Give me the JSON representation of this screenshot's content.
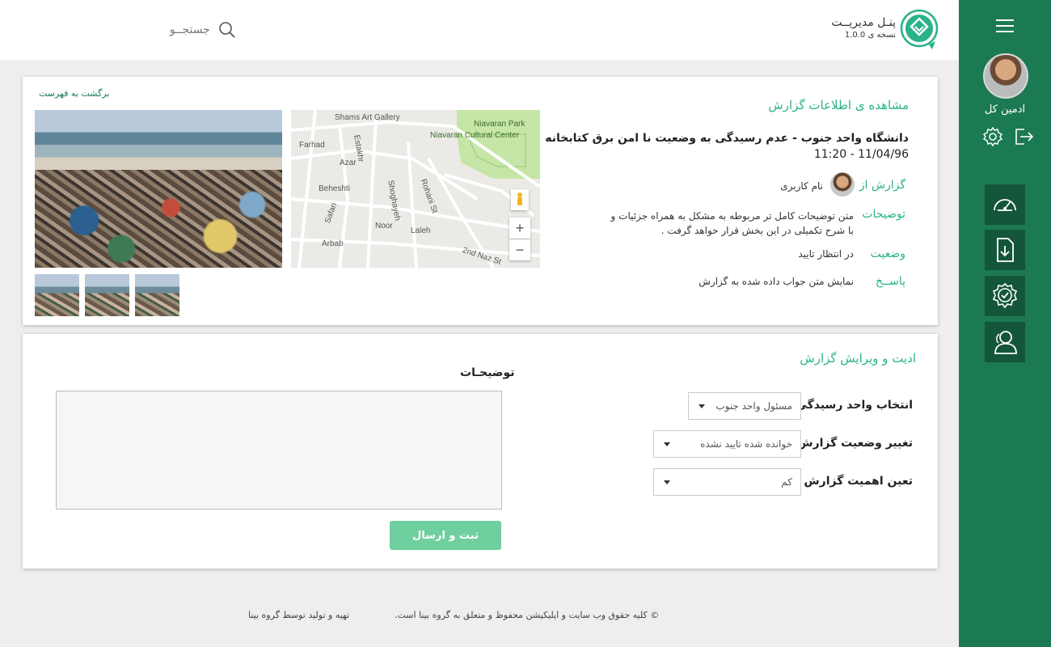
{
  "header": {
    "brand_title": "پنـل مدیریــت",
    "brand_version": "نسخه ی 1.0.0",
    "search_label": "جستجــو"
  },
  "sidebar": {
    "user_name": "ادمین کل",
    "nav_icons": [
      "dashboard-gauge-icon",
      "document-download-icon",
      "badge-check-icon",
      "users-icon"
    ]
  },
  "report": {
    "section_title": "مشاهده ی اطلاعات گزارش",
    "back_link": "برگشت به فهرست",
    "title": "دانشگاه واحد جنوب - عدم رسیدگی به وضعیت نا امن برق کتابخانه",
    "date": "11:20 - 11/04/96",
    "from_label": "گزارش از",
    "from_value": "نام کاربری",
    "desc_label": "توضیحات",
    "desc_value": "متن توضیحات کامل تر مربوطه به مشکل به همراه جزئیات و با شرح تکمیلی در این بخش قرار خواهد گرفت .",
    "status_label": "وضعیت",
    "status_value": "در انتظار تایید",
    "reply_label": "پاســخ",
    "reply_value": "نمایش متن جواب داده شده به گزارش",
    "map_labels": [
      "Shams Art Gallery",
      "Niavaran Park",
      "Niavaran Cultural Center",
      "Farhad",
      "Estakhr",
      "Azar",
      "Beheshti",
      "Shoghayeh",
      "Rohani St",
      "Safari",
      "Noor",
      "Laleh",
      "Arbab",
      "2nd Naz St"
    ]
  },
  "edit": {
    "section_title": "ادیت و ویرایش گزارش",
    "unit_label": "انتخاب واحد رسیدگی",
    "unit_value": "مسئول واحد جنوب",
    "status_label": "تغییر وضعیت گزارش",
    "status_value": "خوانده شده تایید نشده",
    "priority_label": "تعین اهمیت گزارش",
    "priority_value": "کم",
    "desc_label": "توضیحـات",
    "desc_value": "",
    "submit_label": "ثبت و ارسال"
  },
  "footer": {
    "copyright": "© کلیه حقوق وب سایت و اپلیکیشن محفوظ و متعلق به گروه بینا است.",
    "credit": "تهیه و تولید توسط گروه بینا"
  },
  "colors": {
    "sidebar": "#1c7a52",
    "nav_button": "#14563a",
    "accent": "#2bb28a",
    "submit": "#6fcf9f"
  }
}
